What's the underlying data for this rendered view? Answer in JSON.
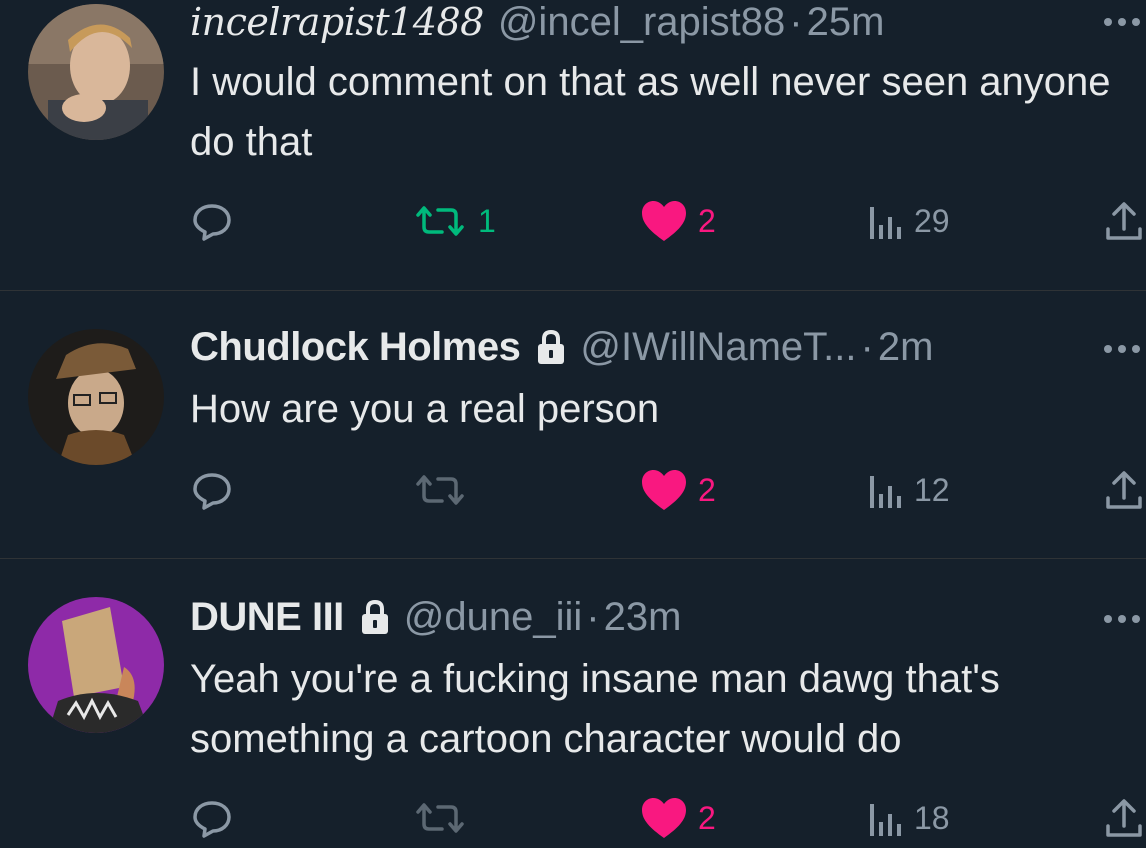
{
  "tweets": [
    {
      "name": "incelrapist1488",
      "handle": "@incel_rapist88",
      "separator": "·",
      "time": "25m",
      "verified_lock": false,
      "text": "I would comment on that as well never seen anyone do that",
      "replies": "",
      "retweets": "1",
      "likes": "2",
      "views": "29",
      "retweeted": true,
      "liked": true
    },
    {
      "name": "Chudlock Holmes",
      "handle": "@IWillNameT...",
      "separator": "·",
      "time": "2m",
      "verified_lock": true,
      "text": "How are you a real person",
      "replies": "",
      "retweets": "",
      "likes": "2",
      "views": "12",
      "retweeted": false,
      "liked": true
    },
    {
      "name": "DUNE III",
      "handle": "@dune_iii",
      "separator": "·",
      "time": "23m",
      "verified_lock": true,
      "text": "Yeah you're a fucking insane man dawg that's something a cartoon character would do",
      "replies": "",
      "retweets": "",
      "likes": "2",
      "views": "18",
      "retweeted": false,
      "liked": true
    }
  ],
  "icons": {
    "reply": "reply-icon",
    "retweet": "retweet-icon",
    "like": "heart-icon",
    "views": "views-icon",
    "share": "share-icon",
    "more": "more-icon",
    "lock": "lock-icon"
  },
  "colors": {
    "background": "#15202b",
    "text": "#e7e9ea",
    "secondary": "#8b98a5",
    "like": "#f91880",
    "retweet": "#00ba7c",
    "divider": "#2f3336"
  }
}
